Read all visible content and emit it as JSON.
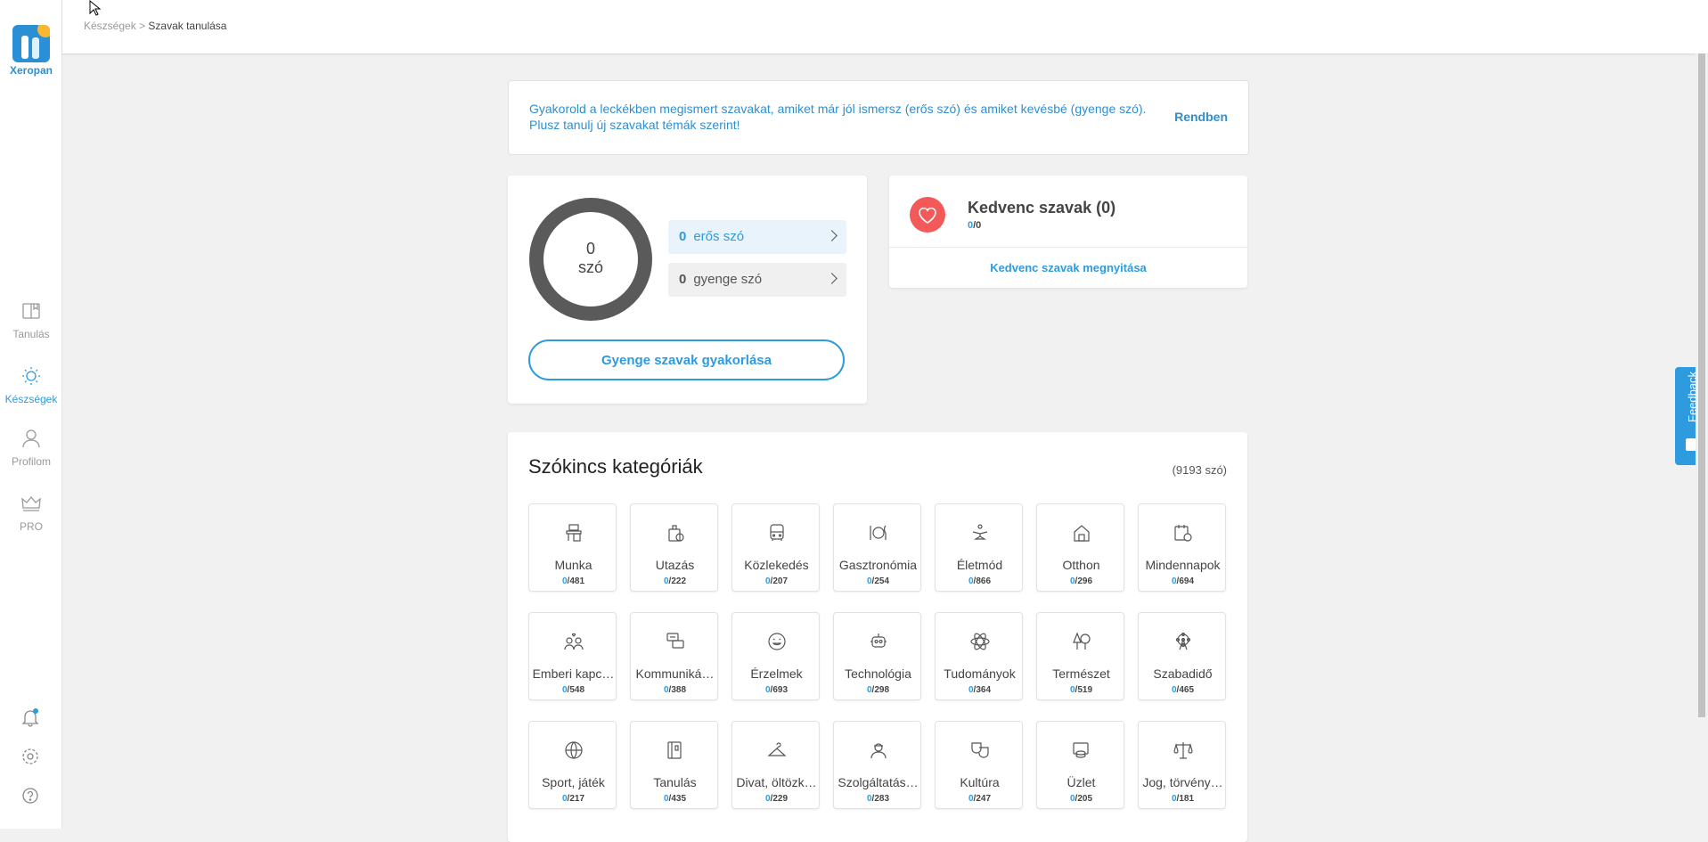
{
  "app": {
    "name": "Xeropan"
  },
  "sidebar": {
    "items": [
      {
        "label": "Tanulás",
        "icon": "book-icon",
        "active": false
      },
      {
        "label": "Készségek",
        "icon": "lightbulb-icon",
        "active": true
      },
      {
        "label": "Profilom",
        "icon": "user-icon",
        "active": false
      },
      {
        "label": "PRO",
        "icon": "crown-icon",
        "active": false
      }
    ],
    "bottom": [
      "bell-icon",
      "gear-icon",
      "help-icon"
    ]
  },
  "breadcrumb": {
    "parent": "Készségek",
    "separator": ">",
    "current": "Szavak tanulása"
  },
  "info": {
    "text": "Gyakorold a leckékben megismert szavakat, amiket már jól ismersz (erős szó) és amiket kevésbé (gyenge szó). Plusz tanulj új szavakat témák szerint!",
    "ok_label": "Rendben"
  },
  "stats": {
    "total": "0",
    "total_unit": "szó",
    "strong_count": "0",
    "strong_label": "erős szó",
    "weak_count": "0",
    "weak_label": "gyenge szó",
    "practice_label": "Gyenge szavak gyakorlása"
  },
  "favorites": {
    "title": "Kedvenc szavak (0)",
    "learned": "0",
    "total": "/0",
    "open_label": "Kedvenc szavak megnyitása"
  },
  "categories": {
    "title": "Szókincs kategóriák",
    "count": "(9193 szó)",
    "items": [
      {
        "name": "Munka",
        "learned": "0",
        "total": "/481",
        "icon": "desk-icon"
      },
      {
        "name": "Utazás",
        "learned": "0",
        "total": "/222",
        "icon": "luggage-icon"
      },
      {
        "name": "Közlekedés",
        "learned": "0",
        "total": "/207",
        "icon": "bus-icon"
      },
      {
        "name": "Gasztronómia",
        "learned": "0",
        "total": "/254",
        "icon": "plate-icon"
      },
      {
        "name": "Életmód",
        "learned": "0",
        "total": "/866",
        "icon": "yoga-icon"
      },
      {
        "name": "Otthon",
        "learned": "0",
        "total": "/296",
        "icon": "house-icon"
      },
      {
        "name": "Mindennapok",
        "learned": "0",
        "total": "/694",
        "icon": "calendar-icon"
      },
      {
        "name": "Emberi kapc…",
        "learned": "0",
        "total": "/548",
        "icon": "people-icon"
      },
      {
        "name": "Kommuniká…",
        "learned": "0",
        "total": "/388",
        "icon": "chat-icon"
      },
      {
        "name": "Érzelmek",
        "learned": "0",
        "total": "/693",
        "icon": "smile-icon"
      },
      {
        "name": "Technológia",
        "learned": "0",
        "total": "/298",
        "icon": "robot-icon"
      },
      {
        "name": "Tudományok",
        "learned": "0",
        "total": "/364",
        "icon": "atom-icon"
      },
      {
        "name": "Természet",
        "learned": "0",
        "total": "/519",
        "icon": "tree-icon"
      },
      {
        "name": "Szabadidő",
        "learned": "0",
        "total": "/465",
        "icon": "ferris-wheel-icon"
      },
      {
        "name": "Sport, játék",
        "learned": "0",
        "total": "/217",
        "icon": "ball-icon"
      },
      {
        "name": "Tanulás",
        "learned": "0",
        "total": "/435",
        "icon": "notebook-icon"
      },
      {
        "name": "Divat, öltözk…",
        "learned": "0",
        "total": "/229",
        "icon": "hanger-icon"
      },
      {
        "name": "Szolgáltatás…",
        "learned": "0",
        "total": "/283",
        "icon": "worker-icon"
      },
      {
        "name": "Kultúra",
        "learned": "0",
        "total": "/247",
        "icon": "masks-icon"
      },
      {
        "name": "Üzlet",
        "learned": "0",
        "total": "/205",
        "icon": "money-icon"
      },
      {
        "name": "Jog, törvény…",
        "learned": "0",
        "total": "/181",
        "icon": "scales-icon"
      }
    ]
  },
  "feedback": {
    "label": "Feedback"
  },
  "colors": {
    "accent": "#2e9bde",
    "heart": "#f25a5a",
    "ring": "#555555"
  }
}
